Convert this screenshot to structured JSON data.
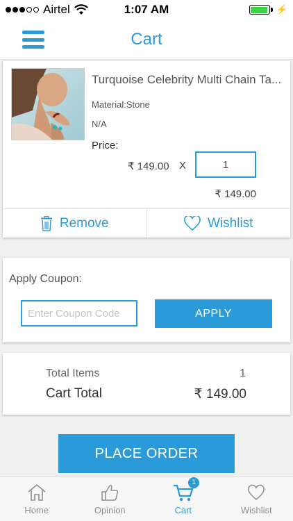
{
  "status_bar": {
    "carrier": "Airtel",
    "time": "1:07 AM",
    "signal_bars": 3,
    "signal_total": 5,
    "battery_level": 0.95,
    "charging": true
  },
  "header": {
    "title": "Cart",
    "menu_icon": "hamburger-menu-icon"
  },
  "cart_item": {
    "name": "Turquoise Celebrity Multi Chain Ta...",
    "material": "Material:Stone",
    "variant": "N/A",
    "price_label": "Price:",
    "unit_price": "₹ 149.00",
    "multiplier": "X",
    "quantity": "1",
    "line_total": "₹ 149.00",
    "remove_label": "Remove",
    "wishlist_label": "Wishlist"
  },
  "coupon": {
    "label": "Apply Coupon:",
    "placeholder": "Enter Coupon Code",
    "apply_label": "APPLY"
  },
  "totals": {
    "items_label": "Total Items",
    "items_value": "1",
    "cart_total_label": "Cart Total",
    "cart_total_value": "₹ 149.00"
  },
  "place_order_label": "PLACE ORDER",
  "bottom_nav": {
    "items": [
      {
        "label": "Home",
        "icon": "home-icon"
      },
      {
        "label": "Opinion",
        "icon": "thumbs-up-icon"
      },
      {
        "label": "Cart",
        "icon": "cart-icon",
        "badge": "1"
      },
      {
        "label": "Wishlist",
        "icon": "heart-icon"
      }
    ],
    "active": "Cart"
  },
  "colors": {
    "accent": "#2a9bd8",
    "background": "#f0f0f0",
    "battery_green": "#3bd143"
  }
}
